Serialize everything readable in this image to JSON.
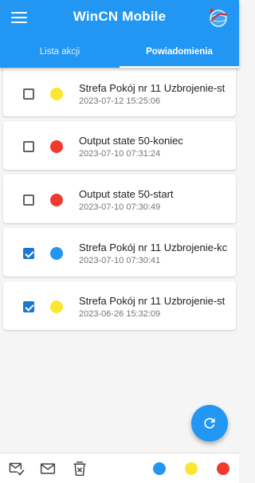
{
  "app": {
    "title": "WinCN Mobile",
    "accent": "#2196f3",
    "menu_icon": "hamburger-menu-icon",
    "logo_icon": "globe-logo-icon"
  },
  "tabs": [
    {
      "label": "Lista akcji",
      "active": false
    },
    {
      "label": "Powiadomienia",
      "active": true
    }
  ],
  "notifications": [
    {
      "checked": false,
      "color": "#fbe731",
      "title": "Strefa Pokój nr 11 Uzbrojenie-st",
      "time": "2023-07-12 15:25:06"
    },
    {
      "checked": false,
      "color": "#ef3b2f",
      "title": "Output state 50-koniec",
      "time": "2023-07-10 07:31:24"
    },
    {
      "checked": false,
      "color": "#ef3b2f",
      "title": "Output state 50-start",
      "time": "2023-07-10 07:30:49"
    },
    {
      "checked": true,
      "color": "#2196f3",
      "title": "Strefa Pokój nr 11 Uzbrojenie-kc",
      "time": "2023-07-10 07:30:41"
    },
    {
      "checked": true,
      "color": "#fbe731",
      "title": "Strefa Pokój nr 11 Uzbrojenie-st",
      "time": "2023-06-26 15:32:09"
    }
  ],
  "fab": {
    "icon": "refresh-icon"
  },
  "bottom_bar": {
    "icons": [
      "mark-all-read-icon",
      "mail-icon",
      "delete-icon"
    ],
    "filter_colors": [
      "#2196f3",
      "#fbe731",
      "#ef3b2f"
    ]
  }
}
